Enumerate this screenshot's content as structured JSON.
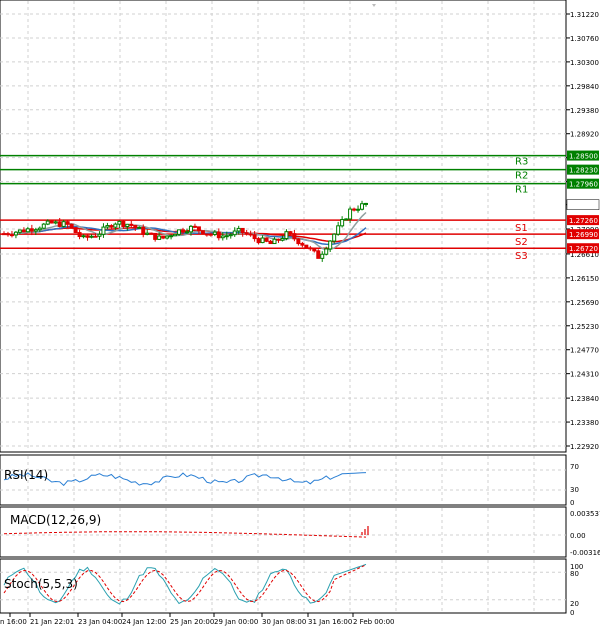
{
  "instrument_chart": {
    "main": {
      "price_ticks": [
        "1.31220",
        "1.30760",
        "1.30300",
        "1.29840",
        "1.29380",
        "1.28920",
        "1.28460",
        "1.28000",
        "1.27557",
        "1.27090",
        "1.26610",
        "1.26150",
        "1.25690",
        "1.25230",
        "1.24770",
        "1.24310",
        "1.23840",
        "1.23380",
        "1.22920"
      ],
      "current_price": "1.27557",
      "levels": [
        {
          "name": "R3",
          "value": "1.28500",
          "color": "#008000"
        },
        {
          "name": "R2",
          "value": "1.28230",
          "color": "#008000"
        },
        {
          "name": "R1",
          "value": "1.27960",
          "color": "#008000"
        },
        {
          "name": "S1",
          "value": "1.27260",
          "color": "#e00000"
        },
        {
          "name": "S2",
          "value": "1.26990",
          "color": "#e00000"
        },
        {
          "name": "S3",
          "value": "1.26720",
          "color": "#e00000"
        }
      ]
    },
    "rsi": {
      "title": "RSI(14)",
      "ticks": [
        "70",
        "30",
        "0"
      ]
    },
    "macd": {
      "title": "MACD(12,26,9)",
      "ticks": [
        "0.003537",
        "0.00",
        "-0.003165"
      ]
    },
    "stoch": {
      "title": "Stoch(5,5,3)",
      "ticks": [
        "100",
        "80",
        "20",
        "0"
      ]
    },
    "time_labels": [
      "n 16:00",
      "21 Jan 22:01",
      "23 Jan 04:00",
      "24 Jan 12:00",
      "25 Jan 20:00",
      "29 Jan 00:00",
      "30 Jan 08:00",
      "31 Jan 16:00",
      "2 Feb 00:00"
    ],
    "colors": {
      "bull": "#008000",
      "bear": "#e00000",
      "grid": "#d0d0d0",
      "ma_red": "#e00000",
      "ma_blue": "#3070c0",
      "rsi_line": "#2a7fd4",
      "macd_bar": "#e00000"
    }
  }
}
